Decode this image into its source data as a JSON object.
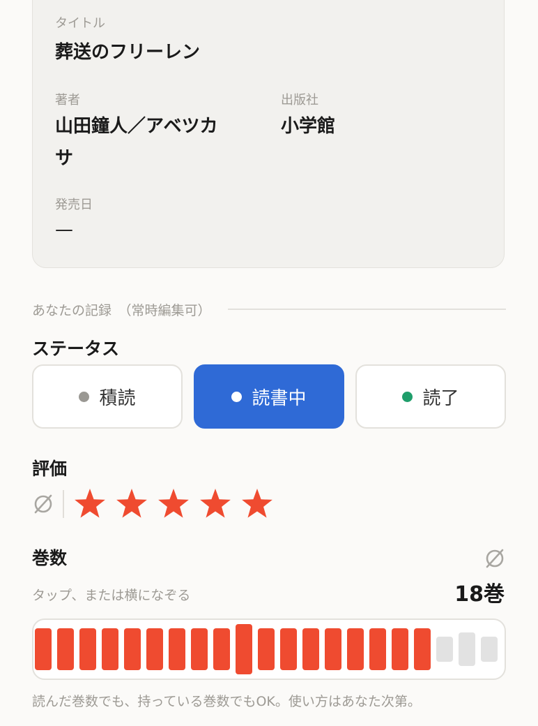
{
  "book": {
    "title_label": "タイトル",
    "title": "葬送のフリーレン",
    "author_label": "著者",
    "author_line1": "山田鐘人／アベツカ",
    "author_line2": "サ",
    "publisher_label": "出版社",
    "publisher": "小学館",
    "release_label": "発売日",
    "release": "—"
  },
  "record": {
    "section_title": "あなたの記録　（常時編集可）"
  },
  "status": {
    "title": "ステータス",
    "options": [
      {
        "label": "積読",
        "dot_color": "#9a9893"
      },
      {
        "label": "読書中",
        "dot_color": "#ffffff"
      },
      {
        "label": "読了",
        "dot_color": "#1f9e6b"
      }
    ],
    "selected": "読書中"
  },
  "rating": {
    "title": "評価",
    "clear_icon": "empty-set-icon",
    "value": 5,
    "max": 5,
    "star_color": "#ef4b30"
  },
  "volumes": {
    "title": "巻数",
    "hint": "タップ、または横になぞる",
    "count_text": "18巻",
    "filled": 18,
    "total": 21,
    "filled_color": "#ef4b30",
    "empty_color": "#e2e2e2",
    "clear_icon": "empty-set-icon",
    "note": "読んだ巻数でも、持っている巻数でもOK。使い方はあなた次第。"
  },
  "colors": {
    "accent": "#2f6ad6",
    "background": "#fbfaf8"
  }
}
